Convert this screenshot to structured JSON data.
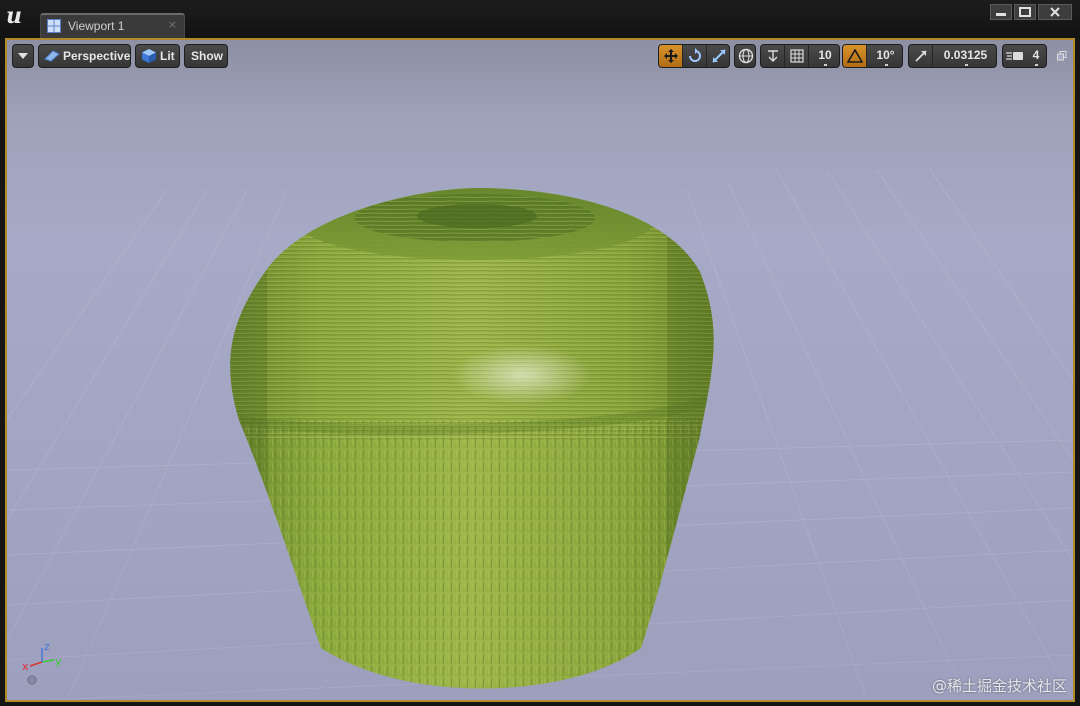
{
  "window": {
    "tab_label": "Viewport 1",
    "tab_close_glyph": "×",
    "logo_glyph": "u"
  },
  "toolbar": {
    "menu_icon": "chevron-down-icon",
    "perspective_label": "Perspective",
    "lit_label": "Lit",
    "show_label": "Show",
    "grid_snap_value": "10",
    "rotation_snap_value": "10°",
    "scale_snap_value": "0.03125",
    "camera_speed_value": "4"
  },
  "gizmo": {
    "x_label": "x",
    "y_label": "y",
    "z_label": "z"
  },
  "watermark": "@稀土掘金技术社区",
  "colors": {
    "accent": "#c88324",
    "viewport_border": "#b08a2a",
    "sky": "#a7aac6",
    "mesh_green": "#8aa63c"
  }
}
